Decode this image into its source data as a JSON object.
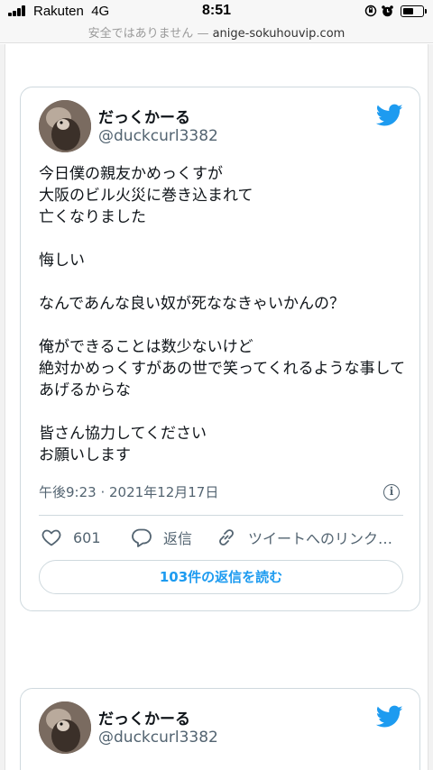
{
  "status_bar": {
    "carrier": "Rakuten",
    "network": "4G",
    "time": "8:51"
  },
  "url_bar": {
    "security_warning": "安全ではありません",
    "separator": "—",
    "domain": "anige-sokuhouvip.com"
  },
  "tweets": [
    {
      "display_name": "だっくかーる",
      "handle": "@duckcurl3382",
      "lines": [
        "今日僕の親友かめっくすが",
        "大阪のビル火災に巻き込まれて",
        "亡くなりました",
        "",
        "悔しい",
        "",
        "なんであんな良い奴が死ななきゃいかんの？",
        "",
        "俺ができることは数少ないけど",
        "絶対かめっくすがあの世で笑ってくれるような事して",
        "あげるからな",
        "",
        "皆さん協力してください",
        "お願いします"
      ],
      "timestamp": "午後9:23 · 2021年12月17日",
      "like_count": "601",
      "reply_label": "返信",
      "share_label": "ツイートへのリンク…",
      "read_replies_label": "103件の返信を読む"
    },
    {
      "display_name": "だっくかーる",
      "handle": "@duckcurl3382"
    }
  ],
  "colors": {
    "twitter_blue": "#1d9bf0",
    "text_primary": "#0f1419",
    "text_secondary": "#536471",
    "border": "#cfd9de"
  }
}
